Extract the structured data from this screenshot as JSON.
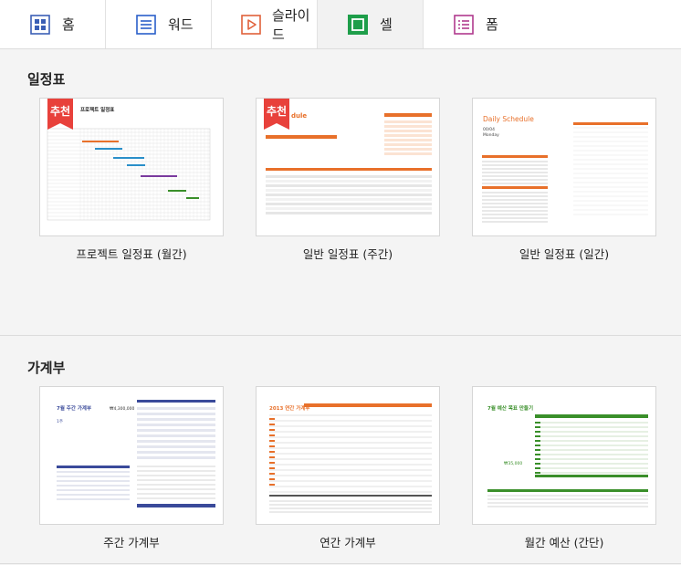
{
  "tabs": [
    {
      "label": "홈",
      "icon": "home-grid-icon",
      "color": "#3b5fb5"
    },
    {
      "label": "워드",
      "icon": "word-doc-icon",
      "color": "#2a5fc9"
    },
    {
      "label": "슬라이드",
      "icon": "slide-play-icon",
      "color": "#e0603a"
    },
    {
      "label": "셀",
      "icon": "cell-sheet-icon",
      "color": "#1e9e4a"
    },
    {
      "label": "폼",
      "icon": "form-list-icon",
      "color": "#b03a8e"
    }
  ],
  "active_tab": "셀",
  "sections": [
    {
      "title": "일정표",
      "cards": [
        {
          "label": "프로젝트 일정표 (월간)",
          "recommended": true,
          "thumb_title": "프로젝트 일정표"
        },
        {
          "label": "일반 일정표 (주간)",
          "recommended": true,
          "thumb_title": "dule"
        },
        {
          "label": "일반 일정표 (일간)",
          "recommended": false,
          "thumb_title": "Daily Schedule",
          "thumb_date": "00/04",
          "thumb_day": "Monday"
        }
      ]
    },
    {
      "title": "가계부",
      "cards": [
        {
          "label": "주간 가계부",
          "recommended": false,
          "thumb_title": "7월 주간 가계부",
          "thumb_sub": "1주",
          "thumb_amount": "₩4,300,000"
        },
        {
          "label": "연간 가계부",
          "recommended": false,
          "thumb_title": "2013 연간 가계부"
        },
        {
          "label": "월간 예산 (간단)",
          "recommended": false,
          "thumb_title": "7월 예산 목표 만들기",
          "thumb_amount": "₩35,000"
        }
      ]
    }
  ],
  "badge_text": "추천",
  "colors": {
    "badge": "#e8413b",
    "orange": "#e8702a",
    "navy": "#3a4a9a",
    "green": "#3a8f2a"
  }
}
